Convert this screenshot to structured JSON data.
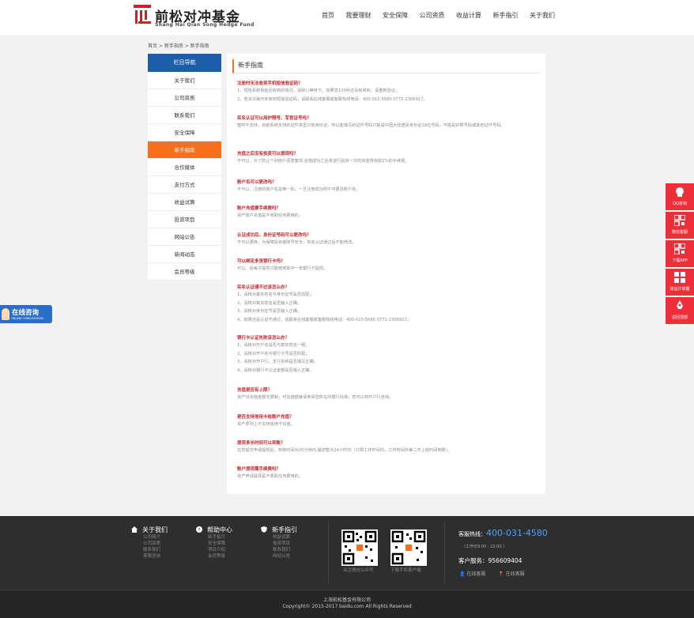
{
  "brand": {
    "name_cn": "前松对冲基金",
    "name_en": "Shang Hai Qian Song Hedge Fund",
    "accent": "#f96e18",
    "primary": "#1d5ea8",
    "question_red": "#c8222a"
  },
  "nav": [
    "首页",
    "我要理财",
    "安全保障",
    "公司资质",
    "收益计算",
    "新手指引",
    "关于我们"
  ],
  "breadcrumb": "首页 > 新手指南 > 新手指南",
  "sidebar": {
    "title": "栏目导航",
    "items": [
      {
        "label": "关于我们",
        "active": false
      },
      {
        "label": "公司资质",
        "active": false
      },
      {
        "label": "联系我们",
        "active": false
      },
      {
        "label": "安全保障",
        "active": false
      },
      {
        "label": "新手指南",
        "active": true
      },
      {
        "label": "合作媒体",
        "active": false
      },
      {
        "label": "支付方式",
        "active": false
      },
      {
        "label": "收益试算",
        "active": false
      },
      {
        "label": "投资项目",
        "active": false
      },
      {
        "label": "网站公告",
        "active": false
      },
      {
        "label": "新闻动态",
        "active": false
      },
      {
        "label": "会员等级",
        "active": false
      }
    ]
  },
  "main": {
    "title": "新手指南",
    "faqs": [
      {
        "q": "注册时无法收到手机短信验证码？",
        "a": "1、短信系统有延迟收到的情况，请耐心等待下。如果您120秒还没有收到，请重新验证；\n2、若多次操作未收到短信验证码，请联系在线客服或客服热线电话：400-015-5680 0771-2306917。"
      },
      {
        "q": "实名认证可以用护照号、军官证号吗？",
        "a": "暂时不支持，目前系统支持的证件类型只有身份证，所以能填写的证件号码只能是中国大陆居民身份证18位号码，不能是护照号码或其他证件号码。"
      },
      {
        "q": "充值之后没有投资可以提现吗？",
        "a": "不可以，为了防止个别用户恶意套现,充值成功之后未进行投资一次的资金将收取2%的手续费。"
      },
      {
        "q": "账户名可以更改吗？",
        "a": "不可以，注册的账户名是唯一的，一旦注册成功则不可更改账户名。"
      },
      {
        "q": "账户充值要手续费吗？",
        "a": "资产账户充值是不收取任何费用的。"
      },
      {
        "q": "认证成功后，身份证号码可以更改吗？",
        "a": "不可以更换，为保障投资者账号安全，实名认证通过后不能修改。"
      },
      {
        "q": "可以绑定多张银行卡吗？",
        "a": "可以。后每次提现只能使用其中一张银行卡提现。"
      },
      {
        "q": "实名认证通不过该怎么办？",
        "a": "1、请核对真实姓名与身份证号是否匹配；\n2、请核对真实姓名是否输入正确；\n3、请核对身份证号是否输入正确；\n4、如果还是认证不通过，请联系在线客服或客服热线电话：400-015-5680 0771-2306917。"
      },
      {
        "q": "银行卡认证失败该怎么办？",
        "a": "1、请核对开户名是否与真实姓名一致；\n2、请核对开户名与银行卡号是否匹配；\n3、请核对开户行、支行名称是否填写正确；\n4、请核对银行卡认证金额是否输入正确。"
      },
      {
        "q": "充值是否有上限？",
        "a": "资产对充值金额无限制，可充值额度请参阅您所在的银行标准；您可以到开户行咨询。"
      },
      {
        "q": "是否支持信用卡给账户充值？",
        "a": "资产原则上不支持信用卡充值。"
      },
      {
        "q": "提现多长时间可以到账？",
        "a": "在您提交申请提现后，到账时间为20分钟内,最前暂允24小时内（只限工作时间内，工作时间外第二天上班时间到账）。"
      },
      {
        "q": "账户提现需手续费吗？",
        "a": "资产申请提现是不收取任何费用的。"
      }
    ]
  },
  "float_left": {
    "title": "在线咨询",
    "subtitle": "ONLINE CONSULTATION"
  },
  "float_right": [
    {
      "label": "QQ咨询",
      "icon": "qq-icon"
    },
    {
      "label": "微信客服",
      "icon": "qrcode-icon"
    },
    {
      "label": "下载APP",
      "icon": "qrcode-icon"
    },
    {
      "label": "收益计算器",
      "icon": "calculator-icon"
    },
    {
      "label": "返回顶部",
      "icon": "rocket-icon"
    }
  ],
  "footer": {
    "cols": [
      {
        "title": "关于我们",
        "icon": "home-icon",
        "links": [
          "公司简介",
          "公司资质",
          "联系我们",
          "客服咨询"
        ]
      },
      {
        "title": "帮助中心",
        "icon": "help-icon",
        "links": [
          "新手指引",
          "安全保障",
          "项目介绍",
          "会员等级"
        ]
      },
      {
        "title": "新手指引",
        "icon": "shield-icon",
        "links": [
          "收益试算",
          "投资项目",
          "联系我们",
          "网站公告"
        ]
      }
    ],
    "qr1_caption": "关注微信公众号",
    "qr2_caption": "下载手机客户端",
    "hotline_label": "客服热线：",
    "hotline": "400-031-4580",
    "hours": "（工作日9:00 - 22:00 ）",
    "service_label": "客户服务：956609404",
    "online_service_1": "在线客服",
    "online_service_2": "在线客服",
    "company": "上海前松基金有限公司",
    "copyright": "Copyright© 2015-2017 baidu.com All Rights Reserved"
  }
}
